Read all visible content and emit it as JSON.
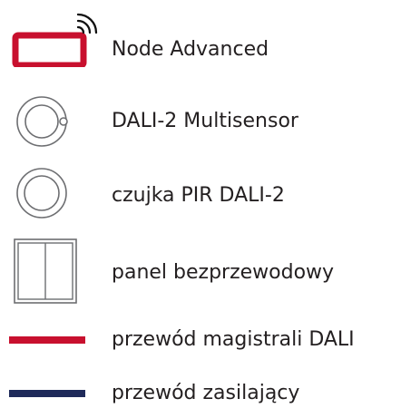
{
  "legend": {
    "items": [
      {
        "id": "node-advanced",
        "icon": "node-advanced-device-icon",
        "label": "Node Advanced"
      },
      {
        "id": "dali2-multisensor",
        "icon": "multisensor-icon",
        "label": "DALI-2 Multisensor"
      },
      {
        "id": "pir-sensor",
        "icon": "pir-sensor-icon",
        "label": "czujka PIR DALI-2"
      },
      {
        "id": "wireless-panel",
        "icon": "wireless-panel-icon",
        "label": "panel bezprzewodowy"
      },
      {
        "id": "dali-bus-wire",
        "icon": "dali-bus-line-icon",
        "label": "przewód magistrali DALI"
      },
      {
        "id": "power-wire",
        "icon": "power-line-icon",
        "label": "przewód zasilający"
      }
    ]
  },
  "colors": {
    "node": "#c8102e",
    "dali_line": "#c8102e",
    "power_line": "#1f2a5a",
    "outline": "#6d6e71",
    "text": "#231f20"
  }
}
